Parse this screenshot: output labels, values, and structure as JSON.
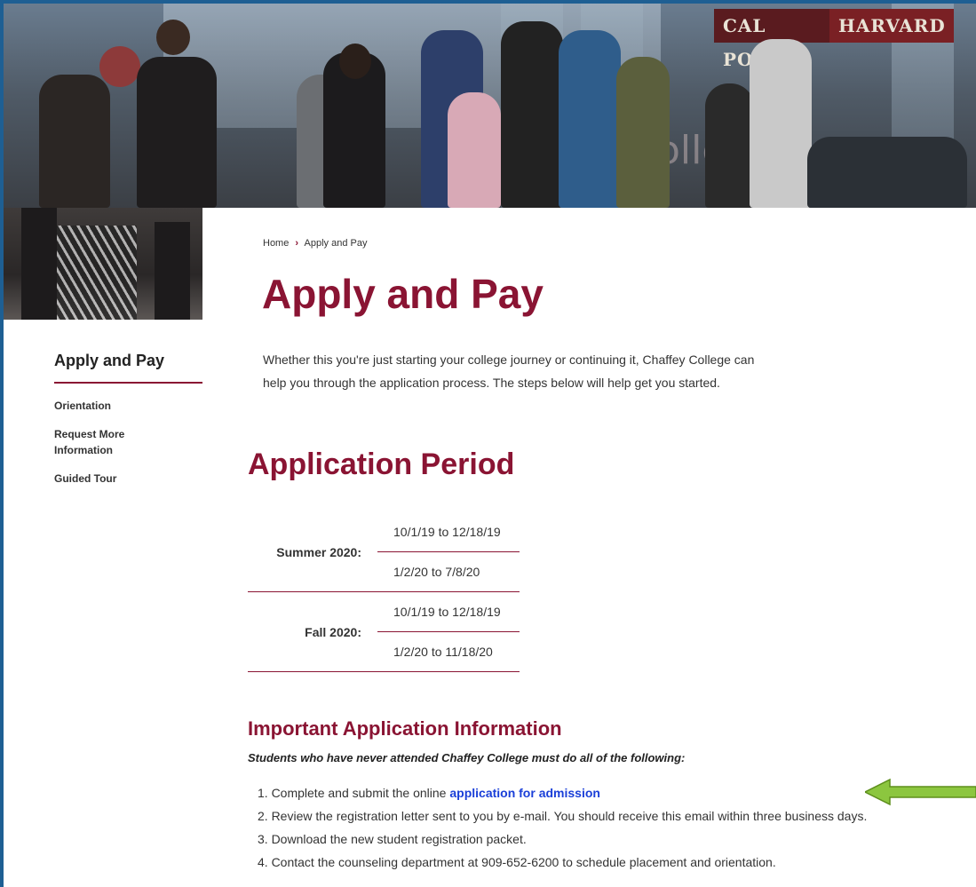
{
  "hero": {
    "banner_left": "CAL POLY",
    "banner_right": "HARVARD",
    "overlay": "olle"
  },
  "sidebar": {
    "title": "Apply and Pay",
    "items": [
      {
        "label": "Orientation"
      },
      {
        "label": "Request More Information"
      },
      {
        "label": "Guided Tour"
      }
    ]
  },
  "breadcrumb": {
    "home": "Home",
    "separator": "›",
    "current": "Apply and Pay"
  },
  "page": {
    "title": "Apply and Pay",
    "intro": "Whether this you're just starting your college journey or continuing it, Chaffey College can help you through the application process. The steps below will help get you started."
  },
  "application_period": {
    "heading": "Application Period",
    "terms": [
      {
        "label": "Summer 2020:",
        "dates": [
          "10/1/19 to 12/18/19",
          "1/2/20 to 7/8/20"
        ]
      },
      {
        "label": "Fall 2020:",
        "dates": [
          "10/1/19 to 12/18/19",
          "1/2/20 to 11/18/20"
        ]
      }
    ]
  },
  "important": {
    "heading": "Important Application Information",
    "note": "Students who have never attended Chaffey College must do all of the following:",
    "steps": [
      {
        "prefix": "1. Complete and submit the online ",
        "link": "application for admission"
      },
      {
        "text": "2. Review the registration letter sent to you by e-mail. You should receive this email within three business days."
      },
      {
        "text": "3. Download the new student registration packet."
      },
      {
        "text": "4. Contact the counseling department at 909-652-6200 to schedule placement and orientation."
      }
    ]
  },
  "colors": {
    "brand": "#8a1433",
    "link": "#1a3fd8",
    "arrow": "#8cc63f",
    "frame": "#1e5f93"
  }
}
